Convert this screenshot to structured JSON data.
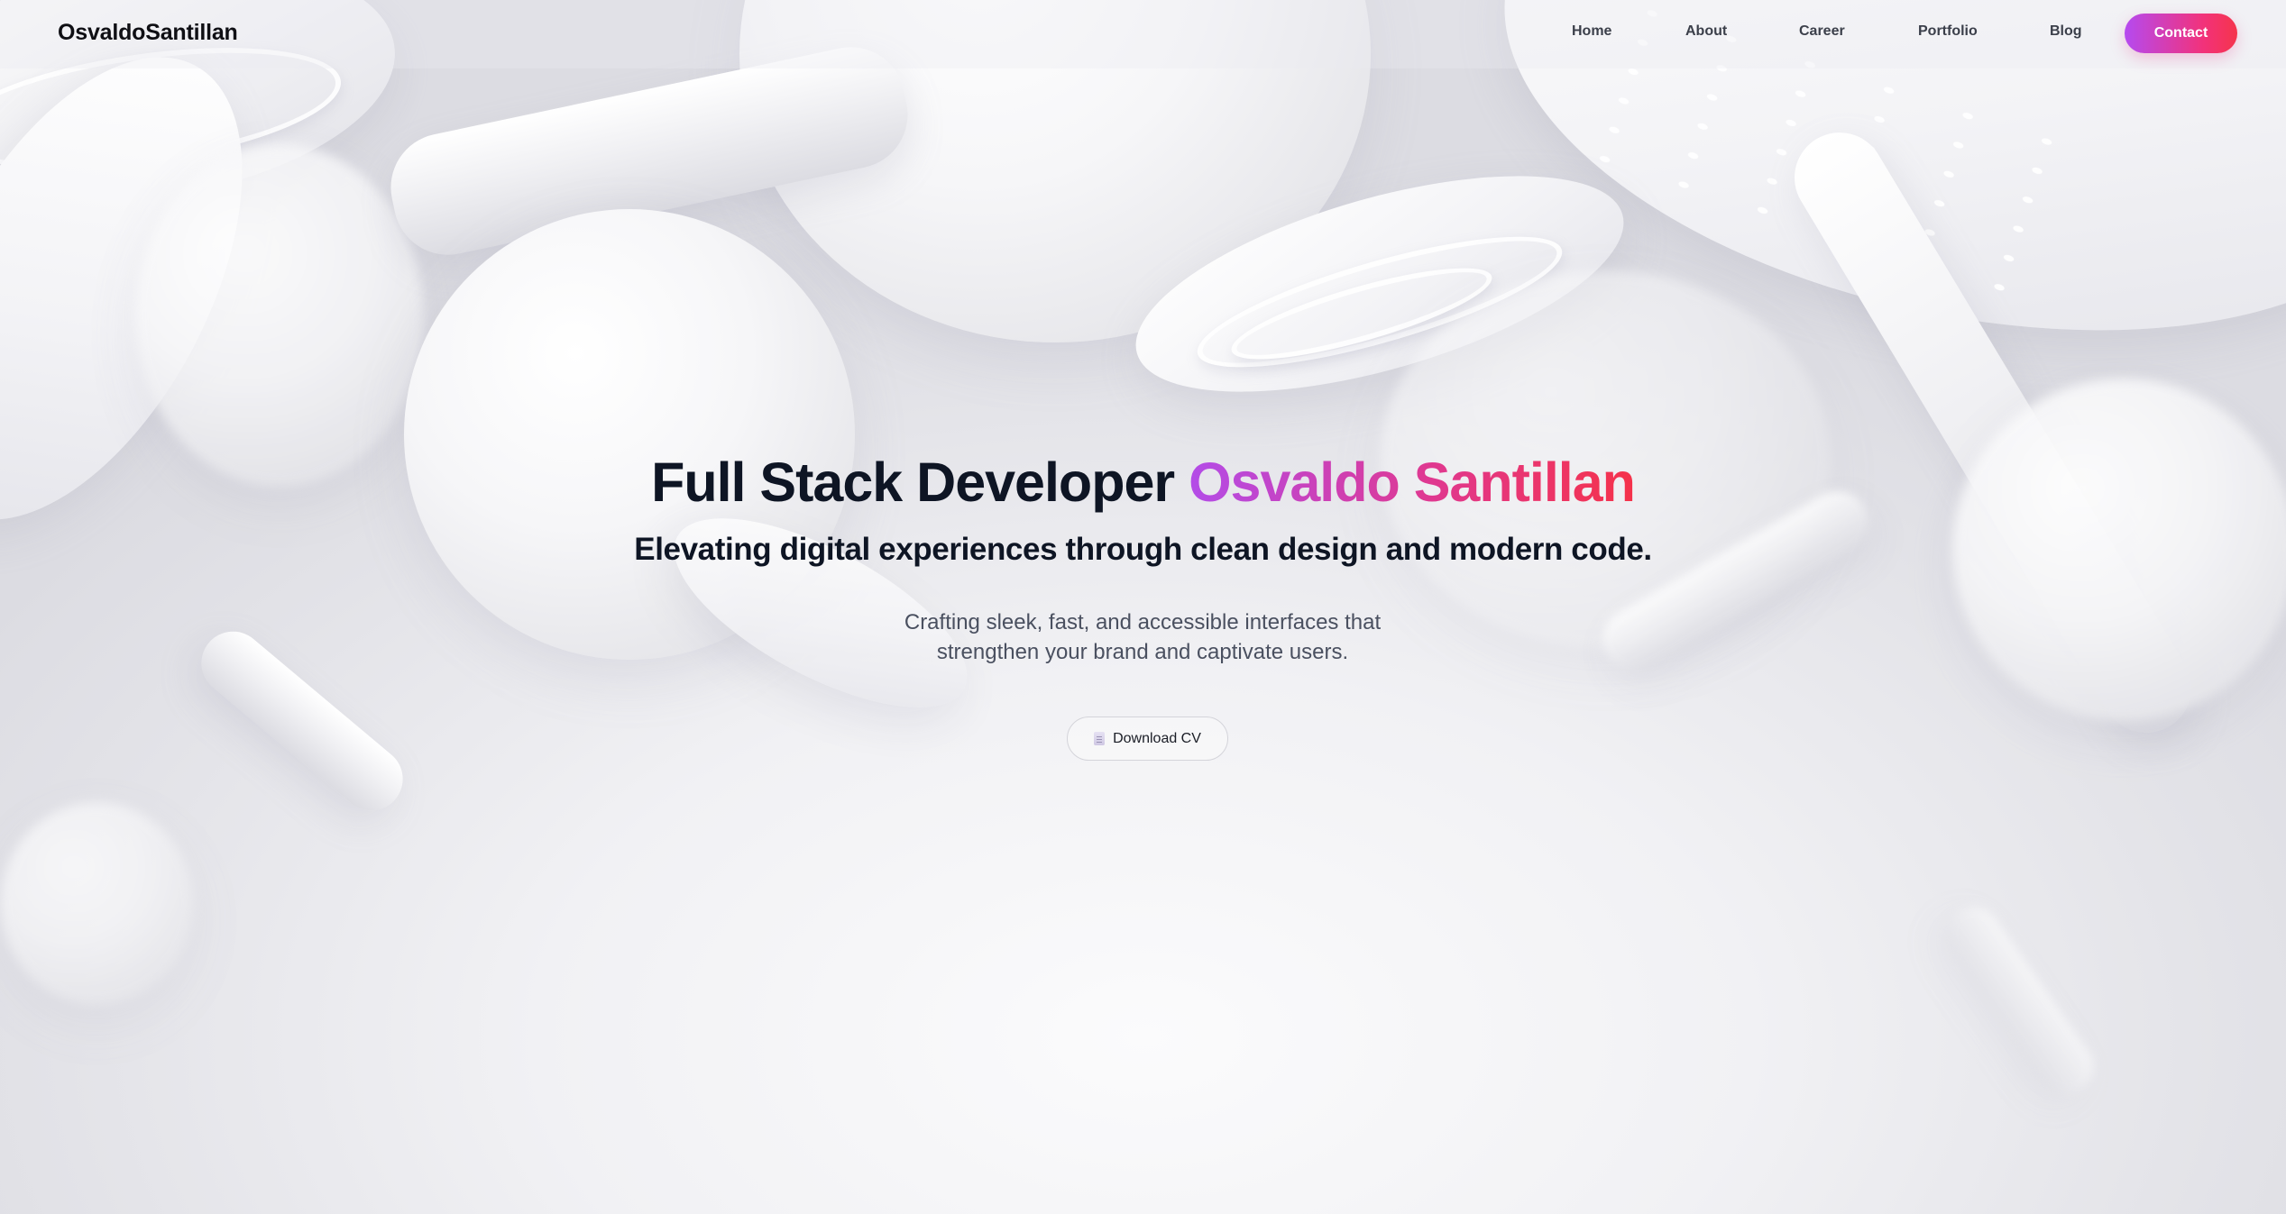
{
  "brand": {
    "logo_text": "OsvaldoSantillan"
  },
  "nav": {
    "items": [
      {
        "label": "Home"
      },
      {
        "label": "About"
      },
      {
        "label": "Career"
      },
      {
        "label": "Portfolio"
      },
      {
        "label": "Blog"
      }
    ],
    "contact_label": "Contact"
  },
  "hero": {
    "title_prefix": "Full Stack Developer",
    "title_name": "Osvaldo Santillan",
    "subtitle": "Elevating digital experiences through clean design and modern code.",
    "description": "Crafting sleek, fast, and accessible interfaces that strengthen your brand and captivate users.",
    "cv_button_label": "Download CV",
    "cv_button_icon": "document-icon"
  },
  "colors": {
    "accent_gradient_start": "#b54af0",
    "accent_gradient_end": "#f5344c",
    "text_dark": "#0e1524",
    "text_muted": "#4a5060"
  }
}
